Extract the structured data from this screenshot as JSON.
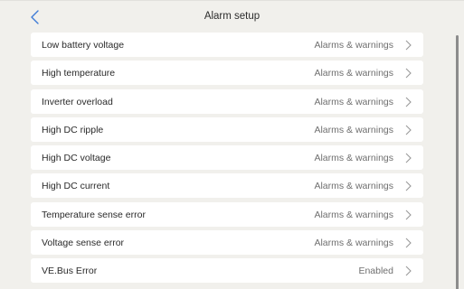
{
  "header": {
    "title": "Alarm setup",
    "back_icon": "chevron-left-icon"
  },
  "colors": {
    "background": "#f1f0ec",
    "row_background": "#ffffff",
    "accent": "#3e7bd6",
    "value_text": "#6f6f6f"
  },
  "items": [
    {
      "label": "Low battery voltage",
      "value": "Alarms & warnings"
    },
    {
      "label": "High temperature",
      "value": "Alarms & warnings"
    },
    {
      "label": "Inverter overload",
      "value": "Alarms & warnings"
    },
    {
      "label": "High DC ripple",
      "value": "Alarms & warnings"
    },
    {
      "label": "High DC voltage",
      "value": "Alarms & warnings"
    },
    {
      "label": "High DC current",
      "value": "Alarms & warnings"
    },
    {
      "label": "Temperature sense error",
      "value": "Alarms & warnings"
    },
    {
      "label": "Voltage sense error",
      "value": "Alarms & warnings"
    },
    {
      "label": "VE.Bus Error",
      "value": "Enabled"
    }
  ]
}
